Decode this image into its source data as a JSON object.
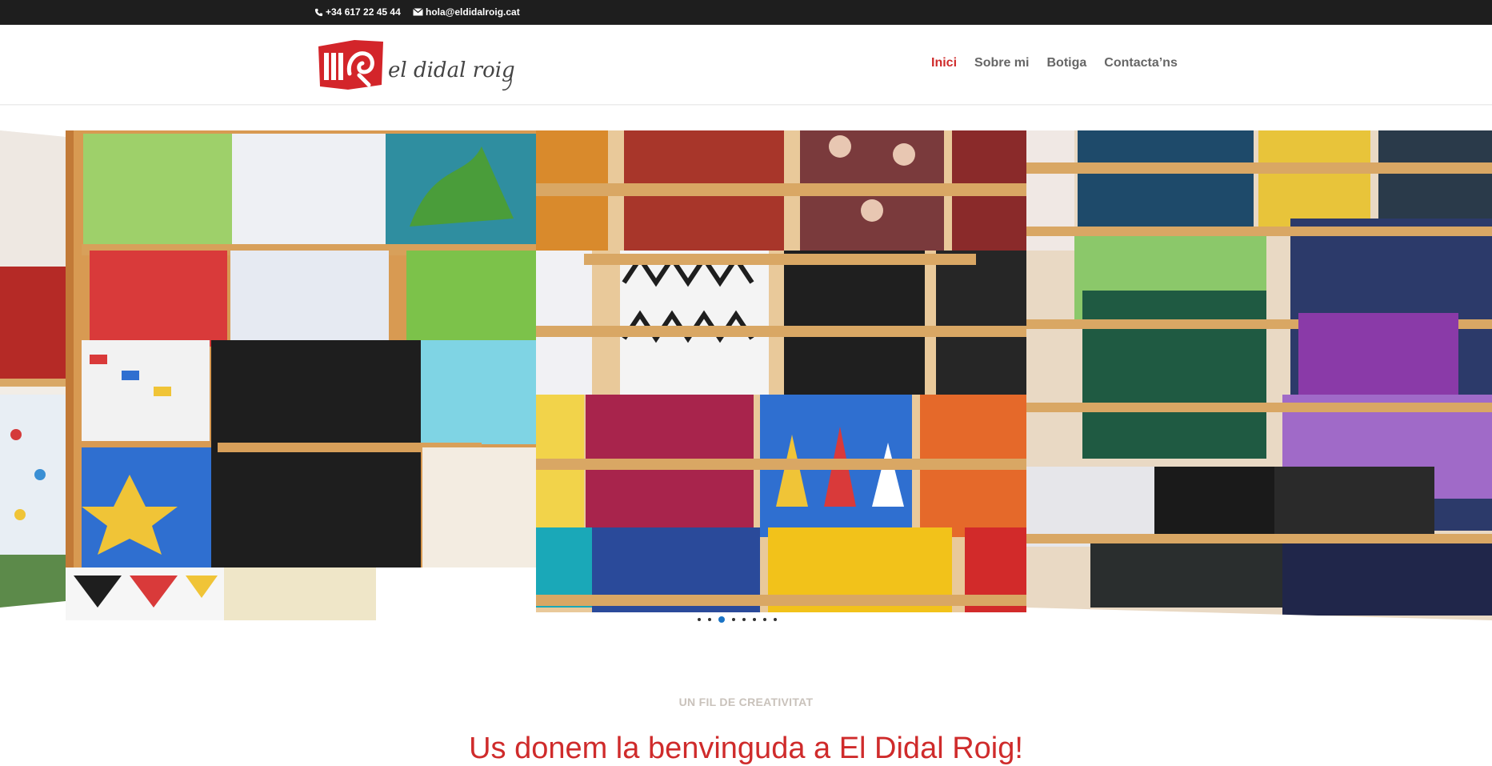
{
  "topbar": {
    "phone": "+34 617 22 45 44",
    "email": "hola@eldidalroig.cat",
    "phone_icon": "phone-icon",
    "email_icon": "envelope-icon"
  },
  "header": {
    "logo_text": "el didal roig",
    "nav": [
      {
        "label": "Inici",
        "active": true
      },
      {
        "label": "Sobre mi",
        "active": false
      },
      {
        "label": "Botiga",
        "active": false
      },
      {
        "label": "Contacta’ns",
        "active": false
      }
    ]
  },
  "slider": {
    "slide_count": 8,
    "active_index": 2
  },
  "intro": {
    "eyebrow": "UN FIL DE CREATIVITAT",
    "headline": "Us donem la benvinguda a El Didal Roig!"
  },
  "colors": {
    "accent": "#cf2b2b",
    "topbar_bg": "#1e1e1e",
    "nav_text": "#666666",
    "dot_active": "#1a73c5"
  }
}
